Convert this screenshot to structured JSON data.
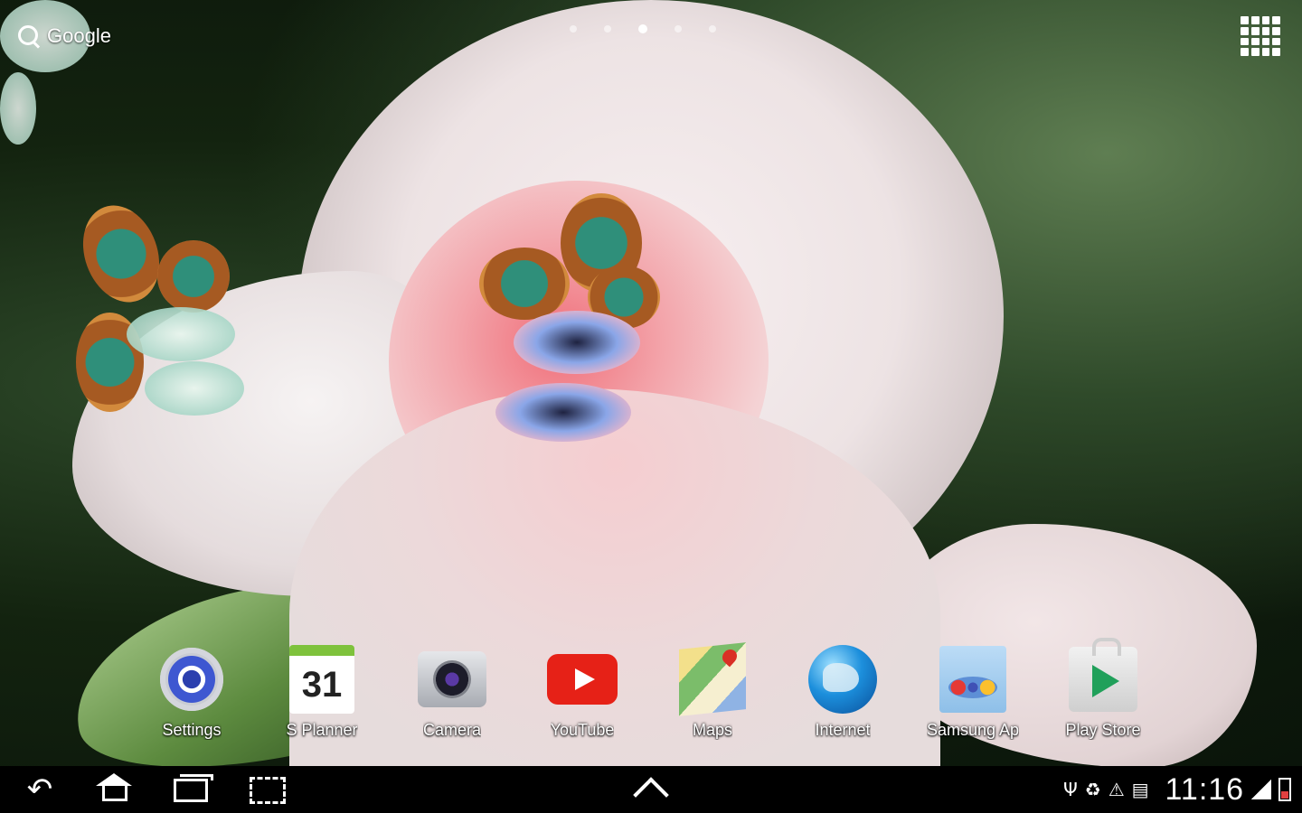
{
  "home_screen": {
    "search": {
      "label": "Google",
      "icon": "search-icon"
    },
    "page_indicator": {
      "count": 5,
      "active_index": 2
    },
    "apps_button": {
      "icon": "apps-grid-icon"
    }
  },
  "dock": {
    "items": [
      {
        "label": "Settings",
        "icon": "settings-icon"
      },
      {
        "label": "S Planner",
        "icon": "calendar-icon",
        "badge": "31"
      },
      {
        "label": "Camera",
        "icon": "camera-icon"
      },
      {
        "label": "YouTube",
        "icon": "youtube-icon"
      },
      {
        "label": "Maps",
        "icon": "maps-icon"
      },
      {
        "label": "Internet",
        "icon": "globe-icon"
      },
      {
        "label": "Samsung Ap",
        "icon": "samsung-apps-icon"
      },
      {
        "label": "Play Store",
        "icon": "play-store-icon"
      }
    ]
  },
  "navbar": {
    "back": "back-icon",
    "home": "home-icon",
    "recent": "recent-apps-icon",
    "screenshot": "screenshot-icon",
    "up": "chevron-up-icon"
  },
  "status_bar": {
    "time": "11:16",
    "icons": [
      "usb-icon",
      "recycle-icon",
      "warning-icon",
      "sd-card-icon",
      "signal-icon",
      "battery-icon"
    ]
  }
}
